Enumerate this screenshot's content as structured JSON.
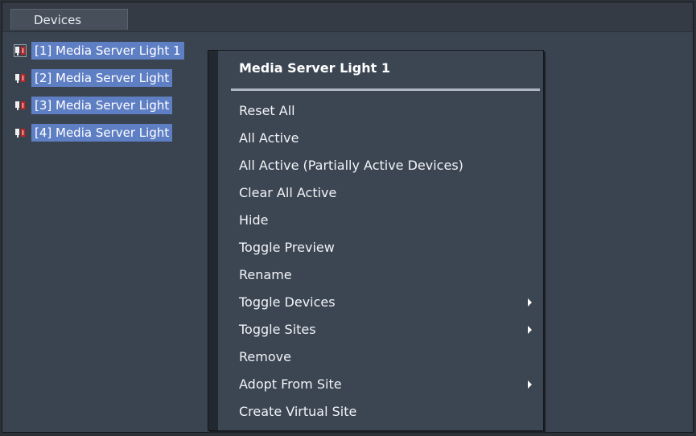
{
  "panel": {
    "tab_label": "Devices"
  },
  "devices": [
    {
      "label": "[1] Media Server Light 1"
    },
    {
      "label": "[2] Media Server Light"
    },
    {
      "label": "[3] Media Server Light"
    },
    {
      "label": "[4] Media Server Light"
    }
  ],
  "context_menu": {
    "title": "Media Server Light 1",
    "items": [
      {
        "label": "Reset All",
        "has_submenu": false
      },
      {
        "label": "All Active",
        "has_submenu": false
      },
      {
        "label": "All Active (Partially Active Devices)",
        "has_submenu": false
      },
      {
        "label": "Clear All Active",
        "has_submenu": false
      },
      {
        "label": "Hide",
        "has_submenu": false
      },
      {
        "label": "Toggle Preview",
        "has_submenu": false
      },
      {
        "label": "Rename",
        "has_submenu": false
      },
      {
        "label": "Toggle Devices",
        "has_submenu": true
      },
      {
        "label": "Toggle Sites",
        "has_submenu": true
      },
      {
        "label": "Remove",
        "has_submenu": false
      },
      {
        "label": "Adopt From Site",
        "has_submenu": true
      },
      {
        "label": "Create Virtual Site",
        "has_submenu": false
      }
    ]
  },
  "icons": {
    "device": "media-server-device-icon",
    "submenu": "submenu-arrow-icon"
  },
  "colors": {
    "selection": "#5f7fc4",
    "background": "#3a4350",
    "menu_background": "#3c4653"
  }
}
